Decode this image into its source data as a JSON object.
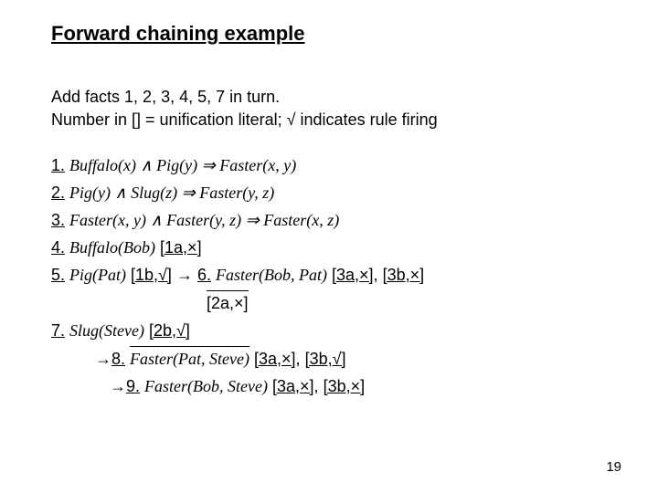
{
  "title": "Forward chaining example",
  "intro": {
    "line1": "Add facts 1, 2, 3, 4, 5, 7 in turn.",
    "line2a": "Number in [] = unification literal; ",
    "line2b": "√",
    "line2c": " indicates rule firing"
  },
  "items": {
    "r1": {
      "num": "1.",
      "body": "Buffalo(x) ∧ Pig(y)  ⇒  Faster(x, y)"
    },
    "r2": {
      "num": "2.",
      "body": "Pig(y) ∧ Slug(z)  ⇒  Faster(y, z)"
    },
    "r3": {
      "num": "3.",
      "body": "Faster(x, y) ∧ Faster(y, z)  ⇒  Faster(x, z)"
    },
    "r4": {
      "num": "4.",
      "body": "Buffalo(Bob)",
      "tag": " [1a,×]"
    },
    "r5": {
      "num": "5.",
      "body": "Pig(Pat)",
      "tag1": " [1b,√]",
      "arrow": " → ",
      "six": "6.",
      "body6": " Faster(Bob, Pat)",
      "tag6a": " [3a,×]",
      "comma": ",",
      "tag6b": " [3b,×]"
    },
    "r5b": {
      "box": "[2a,×]"
    },
    "r7": {
      "num": "7.",
      "body": "Slug(Steve)",
      "tag": " [2b,√]"
    },
    "r8": {
      "arrow": "→",
      "num": "8.",
      "body": " Faster(Pat, Steve)",
      "taga": " [3a,×]",
      "comma": ",",
      "tagb": " [3b,√]"
    },
    "r9": {
      "arrow": "→",
      "num": "9.",
      "body": " Faster(Bob, Steve)",
      "taga": " [3a,×]",
      "comma": ",",
      "tagb": " [3b,×]"
    }
  },
  "page": "19"
}
